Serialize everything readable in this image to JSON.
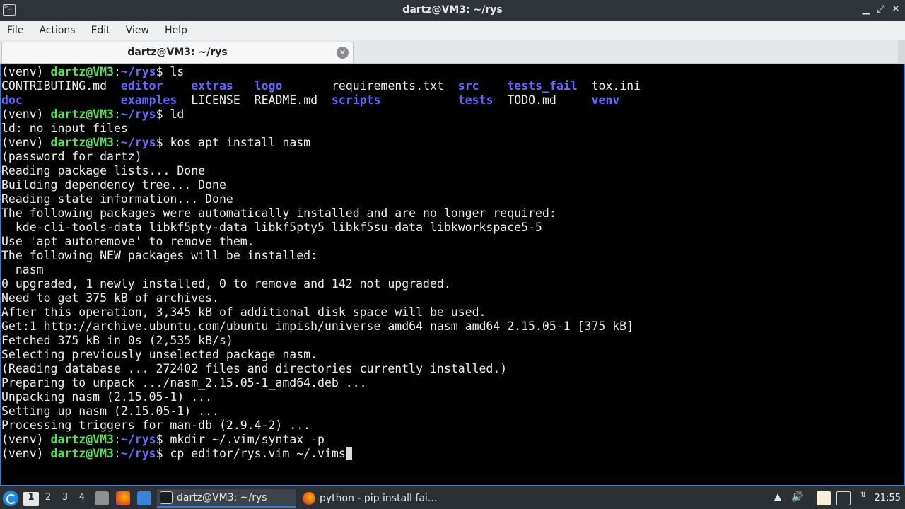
{
  "window": {
    "title": "dartz@VM3: ~/rys",
    "controls": [
      "▁",
      "⤢",
      "✕"
    ]
  },
  "menubar": {
    "items": [
      "File",
      "Actions",
      "Edit",
      "View",
      "Help"
    ]
  },
  "tabs": [
    {
      "label": "dartz@VM3: ~/rys",
      "close": "✕"
    }
  ],
  "terminal": {
    "prompt_env": "(venv) ",
    "prompt_user": "dartz@VM3",
    "prompt_colon": ":",
    "prompt_path": "~/rys",
    "prompt_dollar": "$ ",
    "commands": [
      "ls",
      "ld",
      "kos apt install nasm",
      "mkdir ~/.vim/syntax -p",
      "cp editor/rys.vim ~/.vims"
    ],
    "ls_row1": [
      {
        "text": "CONTRIBUTING.md",
        "dir": false
      },
      {
        "text": "editor",
        "dir": true
      },
      {
        "text": "extras",
        "dir": true
      },
      {
        "text": "logo",
        "dir": true
      },
      {
        "text": "requirements.txt",
        "dir": false
      },
      {
        "text": "src",
        "dir": true
      },
      {
        "text": "tests_fail",
        "dir": true
      },
      {
        "text": "tox.ini",
        "dir": false
      }
    ],
    "ls_row2": [
      {
        "text": "doc",
        "dir": true
      },
      {
        "text": "examples",
        "dir": true
      },
      {
        "text": "LICENSE",
        "dir": false
      },
      {
        "text": "README.md",
        "dir": false
      },
      {
        "text": "scripts",
        "dir": true
      },
      {
        "text": "tests",
        "dir": true
      },
      {
        "text": "TODO.md",
        "dir": false
      },
      {
        "text": "venv",
        "dir": true
      }
    ],
    "ld_output": [
      "ld: no input files"
    ],
    "apt_output": [
      "(password for dartz)",
      "Reading package lists... Done",
      "Building dependency tree... Done",
      "Reading state information... Done",
      "The following packages were automatically installed and are no longer required:",
      "  kde-cli-tools-data libkf5pty-data libkf5pty5 libkf5su-data libkworkspace5-5",
      "Use 'apt autoremove' to remove them.",
      "The following NEW packages will be installed:",
      "  nasm",
      "0 upgraded, 1 newly installed, 0 to remove and 142 not upgraded.",
      "Need to get 375 kB of archives.",
      "After this operation, 3,345 kB of additional disk space will be used.",
      "Get:1 http://archive.ubuntu.com/ubuntu impish/universe amd64 nasm amd64 2.15.05-1 [375 kB]",
      "Fetched 375 kB in 0s (2,535 kB/s)",
      "Selecting previously unselected package nasm.",
      "(Reading database ... 272402 files and directories currently installed.)",
      "Preparing to unpack .../nasm_2.15.05-1_amd64.deb ...",
      "Unpacking nasm (2.15.05-1) ...",
      "Setting up nasm (2.15.05-1) ...",
      "Processing triggers for man-db (2.9.4-2) ..."
    ]
  },
  "taskbar": {
    "workspaces": [
      "1",
      "2",
      "3",
      "4"
    ],
    "active_workspace": "1",
    "tasks": [
      {
        "label": "dartz@VM3: ~/rys",
        "icon": "terminal-icon"
      },
      {
        "label": "python - pip install fai...",
        "icon": "firefox-icon"
      }
    ],
    "clock": "21:55"
  },
  "colors": {
    "prompt_user": "#55e055",
    "directory": "#6666ff",
    "accent": "#3a7bd5"
  }
}
